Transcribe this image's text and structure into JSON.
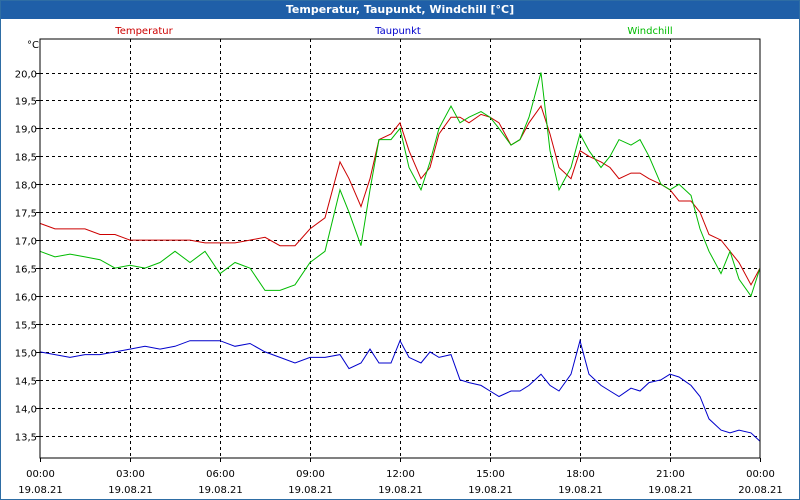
{
  "window": {
    "title": "Temperatur, Taupunkt, Windchill [°C]"
  },
  "colors": {
    "temperatur": "#cc0000",
    "taupunkt": "#0000cc",
    "windchill": "#00bb00",
    "grid": "#000000"
  },
  "chart_data": {
    "type": "line",
    "title": "Temperatur, Taupunkt, Windchill [°C]",
    "ylabel": "°C",
    "ylim": [
      13.1,
      20.6
    ],
    "yticks": [
      "13,5",
      "14,0",
      "14,5",
      "15,0",
      "15,5",
      "16,0",
      "16,5",
      "17,0",
      "17,5",
      "18,0",
      "18,5",
      "19,0",
      "19,5",
      "20,0"
    ],
    "xlim_hours": [
      0,
      24
    ],
    "xticks": [
      {
        "time": "00:00",
        "date": "19.08.21"
      },
      {
        "time": "03:00",
        "date": "19.08.21"
      },
      {
        "time": "06:00",
        "date": "19.08.21"
      },
      {
        "time": "09:00",
        "date": "19.08.21"
      },
      {
        "time": "12:00",
        "date": "19.08.21"
      },
      {
        "time": "15:00",
        "date": "19.08.21"
      },
      {
        "time": "18:00",
        "date": "19.08.21"
      },
      {
        "time": "21:00",
        "date": "19.08.21"
      },
      {
        "time": "00:00",
        "date": "20.08.21"
      }
    ],
    "grid": true,
    "legend": "top",
    "series": [
      {
        "name": "Temperatur",
        "color": "#cc0000",
        "x": [
          0,
          0.5,
          1,
          1.5,
          2,
          2.5,
          3,
          3.5,
          4,
          4.5,
          5,
          5.5,
          6,
          6.5,
          7,
          7.5,
          8,
          8.5,
          9,
          9.5,
          10,
          10.3,
          10.7,
          11,
          11.3,
          11.7,
          12,
          12.3,
          12.7,
          13,
          13.3,
          13.7,
          14,
          14.3,
          14.7,
          15,
          15.3,
          15.7,
          16,
          16.3,
          16.7,
          17,
          17.3,
          17.7,
          18,
          18.3,
          18.7,
          19,
          19.3,
          19.7,
          20,
          20.3,
          20.7,
          21,
          21.3,
          21.7,
          22,
          22.3,
          22.7,
          23,
          23.3,
          23.7,
          24
        ],
        "values": [
          17.3,
          17.2,
          17.2,
          17.2,
          17.1,
          17.1,
          17.0,
          17.0,
          17.0,
          17.0,
          17.0,
          16.95,
          16.95,
          16.95,
          17.0,
          17.05,
          16.9,
          16.9,
          17.2,
          17.4,
          18.4,
          18.1,
          17.6,
          18.1,
          18.8,
          18.9,
          19.1,
          18.6,
          18.1,
          18.3,
          18.9,
          19.2,
          19.2,
          19.1,
          19.25,
          19.2,
          19.1,
          18.7,
          18.8,
          19.1,
          19.4,
          18.9,
          18.3,
          18.1,
          18.6,
          18.5,
          18.4,
          18.3,
          18.1,
          18.2,
          18.2,
          18.1,
          18.0,
          17.9,
          17.7,
          17.7,
          17.5,
          17.1,
          17.0,
          16.8,
          16.6,
          16.2,
          16.5
        ]
      },
      {
        "name": "Taupunkt",
        "color": "#0000cc",
        "x": [
          0,
          0.5,
          1,
          1.5,
          2,
          2.5,
          3,
          3.5,
          4,
          4.5,
          5,
          5.5,
          6,
          6.5,
          7,
          7.5,
          8,
          8.5,
          9,
          9.5,
          10,
          10.3,
          10.7,
          11,
          11.3,
          11.7,
          12,
          12.3,
          12.7,
          13,
          13.3,
          13.7,
          14,
          14.3,
          14.7,
          15,
          15.3,
          15.7,
          16,
          16.3,
          16.7,
          17,
          17.3,
          17.7,
          18,
          18.3,
          18.7,
          19,
          19.3,
          19.7,
          20,
          20.3,
          20.7,
          21,
          21.3,
          21.7,
          22,
          22.3,
          22.7,
          23,
          23.3,
          23.7,
          24
        ],
        "values": [
          15.0,
          14.95,
          14.9,
          14.95,
          14.95,
          15.0,
          15.05,
          15.1,
          15.05,
          15.1,
          15.2,
          15.2,
          15.2,
          15.1,
          15.15,
          15.0,
          14.9,
          14.8,
          14.9,
          14.9,
          14.95,
          14.7,
          14.8,
          15.05,
          14.8,
          14.8,
          15.2,
          14.9,
          14.8,
          15.0,
          14.9,
          14.95,
          14.5,
          14.45,
          14.4,
          14.3,
          14.2,
          14.3,
          14.3,
          14.4,
          14.6,
          14.4,
          14.3,
          14.6,
          15.2,
          14.6,
          14.4,
          14.3,
          14.2,
          14.35,
          14.3,
          14.45,
          14.5,
          14.6,
          14.55,
          14.4,
          14.2,
          13.8,
          13.6,
          13.55,
          13.6,
          13.55,
          13.4
        ]
      },
      {
        "name": "Windchill",
        "color": "#00bb00",
        "x": [
          0,
          0.5,
          1,
          1.5,
          2,
          2.5,
          3,
          3.5,
          4,
          4.5,
          5,
          5.5,
          6,
          6.5,
          7,
          7.5,
          8,
          8.5,
          9,
          9.5,
          10,
          10.3,
          10.7,
          11,
          11.3,
          11.7,
          12,
          12.3,
          12.7,
          13,
          13.3,
          13.7,
          14,
          14.3,
          14.7,
          15,
          15.3,
          15.7,
          16,
          16.3,
          16.7,
          17,
          17.3,
          17.7,
          18,
          18.3,
          18.7,
          19,
          19.3,
          19.7,
          20,
          20.3,
          20.7,
          21,
          21.3,
          21.7,
          22,
          22.3,
          22.7,
          23,
          23.3,
          23.7,
          24
        ],
        "values": [
          16.8,
          16.7,
          16.75,
          16.7,
          16.65,
          16.5,
          16.55,
          16.5,
          16.6,
          16.8,
          16.6,
          16.8,
          16.4,
          16.6,
          16.5,
          16.1,
          16.1,
          16.2,
          16.6,
          16.8,
          17.9,
          17.5,
          16.9,
          17.9,
          18.8,
          18.8,
          19.0,
          18.3,
          17.9,
          18.4,
          19.0,
          19.4,
          19.1,
          19.2,
          19.3,
          19.2,
          19.0,
          18.7,
          18.8,
          19.2,
          20.0,
          18.6,
          17.9,
          18.3,
          18.9,
          18.6,
          18.3,
          18.5,
          18.8,
          18.7,
          18.8,
          18.5,
          18.0,
          17.9,
          18.0,
          17.8,
          17.2,
          16.8,
          16.4,
          16.8,
          16.3,
          16.0,
          16.5
        ]
      }
    ]
  }
}
